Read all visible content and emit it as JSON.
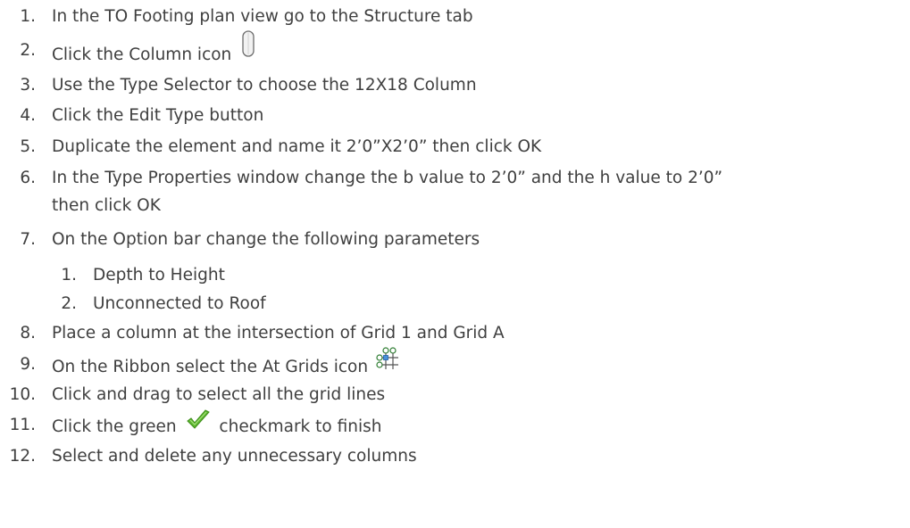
{
  "steps": [
    {
      "num": "1.",
      "text": "In the TO Footing plan view go to the Structure tab"
    },
    {
      "num": "2.",
      "text": "Click the Column icon",
      "icon": "column-icon"
    },
    {
      "num": "3.",
      "text": "Use the Type Selector to choose the 12X18 Column"
    },
    {
      "num": "4.",
      "text": "Click the Edit Type button"
    },
    {
      "num": "5.",
      "text": "Duplicate the element and name it 2’0”X2’0” then click OK"
    },
    {
      "num": "6.",
      "text": "In the Type Properties window change the b value to 2’0” and the h value to 2’0”",
      "cont": "then click OK"
    },
    {
      "num": "7.",
      "text": "On the Option bar change the following parameters"
    },
    {
      "num": "8.",
      "text": "Place a column at the intersection of Grid 1 and Grid A"
    },
    {
      "num": "9.",
      "text": "On the Ribbon select the At Grids icon",
      "icon": "at-grids-icon"
    },
    {
      "num": "10.",
      "text": "Click and drag to select all the grid lines"
    },
    {
      "num": "11.",
      "text_before": "Click the green",
      "text_after": "checkmark to finish",
      "icon": "green-checkmark-icon"
    },
    {
      "num": "12.",
      "text": "Select and delete any unnecessary columns"
    }
  ],
  "substeps": [
    {
      "num": "1.",
      "text": "Depth to Height"
    },
    {
      "num": "2.",
      "text": "Unconnected to Roof"
    }
  ],
  "colors": {
    "text": "#3f3f3f",
    "checkmark": "#5cb82e"
  }
}
